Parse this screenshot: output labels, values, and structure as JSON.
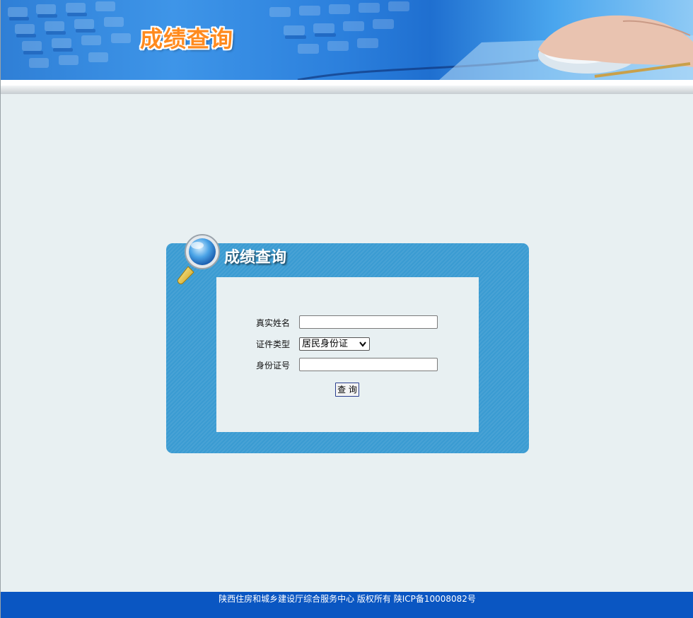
{
  "header": {
    "banner_title": "成绩查询"
  },
  "panel": {
    "title": "成绩查询",
    "fields": {
      "name_label": "真实姓名",
      "name_value": "",
      "id_type_label": "证件类型",
      "id_type_selected": "居民身份证",
      "id_number_label": "身份证号",
      "id_number_value": ""
    },
    "submit_label": "查 询"
  },
  "footer": {
    "text": "陕西住房和城乡建设厅综合服务中心 版权所有 陕ICP备10008082号"
  },
  "colors": {
    "panel_blue": "#3a9bd2",
    "footer_blue": "#0a56c2",
    "page_bg": "#e8f0f2",
    "title_orange": "#ff8a1e"
  },
  "icons": [
    "magnifier-icon",
    "chevron-down-icon"
  ]
}
